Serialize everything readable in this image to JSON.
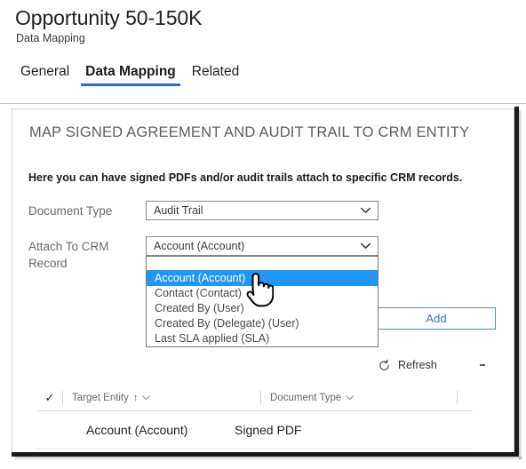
{
  "header": {
    "title": "Opportunity 50-150K",
    "subtitle": "Data Mapping",
    "tabs": [
      {
        "label": "General",
        "active": false
      },
      {
        "label": "Data Mapping",
        "active": true
      },
      {
        "label": "Related",
        "active": false
      }
    ]
  },
  "section": {
    "title": "MAP SIGNED AGREEMENT AND AUDIT TRAIL TO CRM ENTITY",
    "description": "Here you can have signed PDFs and/or audit trails attach to specific CRM records."
  },
  "form": {
    "document_type": {
      "label": "Document Type",
      "value": "Audit Trail"
    },
    "attach_to_crm_record": {
      "label": "Attach To CRM Record",
      "value": "Account (Account)",
      "open": true,
      "options": [
        "",
        "Account (Account)",
        "Contact (Contact)",
        "Created By (User)",
        "Created By (Delegate) (User)",
        "Last SLA applied (SLA)"
      ],
      "selected_index": 1
    },
    "add_button_label": "Add"
  },
  "commandbar": {
    "refresh_label": "Refresh",
    "refresh_icon": "refresh-icon",
    "overflow_icon": "more-vertical-icon"
  },
  "grid": {
    "select_all_icon": "checkmark-icon",
    "columns": [
      {
        "label": "Target Entity",
        "sorted": true,
        "sort_icon": "arrow-up-icon",
        "menu_icon": "chevron-down-icon"
      },
      {
        "label": "Document Type",
        "sorted": false,
        "menu_icon": "chevron-down-icon"
      }
    ],
    "rows": [
      {
        "target_entity": "Account (Account)",
        "document_type": "Signed PDF"
      }
    ]
  },
  "cursor": {
    "icon": "pointing-hand-cursor"
  },
  "colors": {
    "accent": "#2b6cc4",
    "highlight": "#2196f3",
    "link": "#2e7cc4",
    "text": "#201f1e",
    "muted": "#6b6967"
  }
}
